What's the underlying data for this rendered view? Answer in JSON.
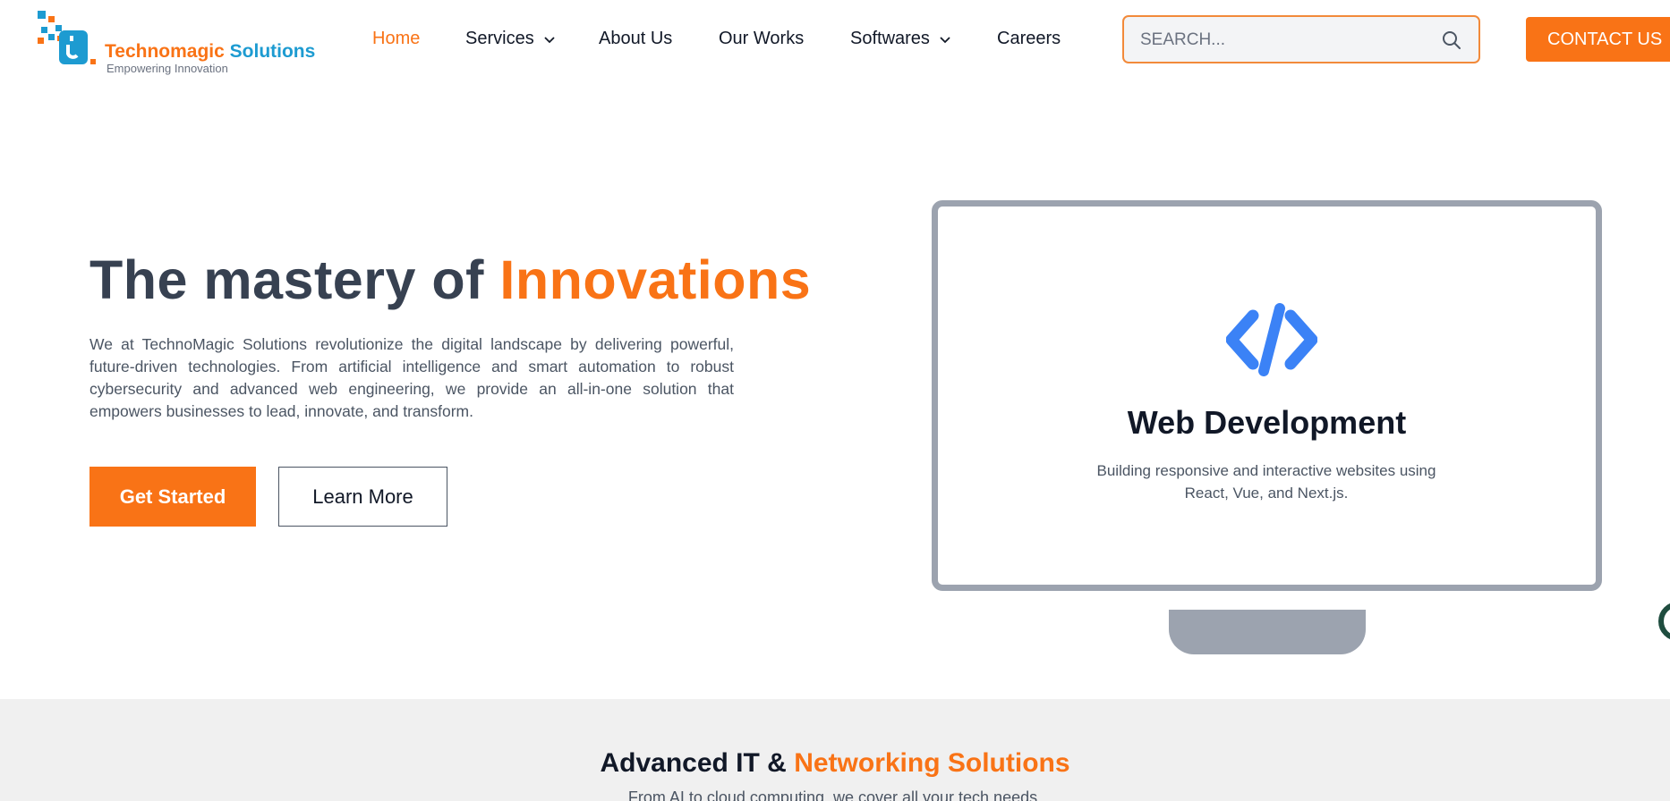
{
  "header": {
    "logo": {
      "name_part1": "Technomagic",
      "name_part2": "Solutions",
      "tagline": "Empowering Innovation"
    },
    "nav": [
      {
        "label": "Home",
        "active": true
      },
      {
        "label": "Services",
        "dropdown": true
      },
      {
        "label": "About Us"
      },
      {
        "label": "Our Works"
      },
      {
        "label": "Softwares",
        "dropdown": true
      },
      {
        "label": "Careers"
      }
    ],
    "search": {
      "placeholder": "SEARCH...",
      "value": ""
    },
    "contact_label": "CONTACT US"
  },
  "hero": {
    "title_part1": "The mastery of",
    "title_accent": "Innovations",
    "description": "We at TechnoMagic Solutions revolutionize the digital landscape by delivering powerful, future-driven technologies. From artificial intelligence and smart automation to robust cybersecurity and advanced web engineering, we provide an all-in-one solution that empowers businesses to lead, innovate, and transform.",
    "primary_cta": "Get Started",
    "secondary_cta": "Learn More"
  },
  "showcase": {
    "icon": "code-icon",
    "title": "Web Development",
    "text": "Building responsive and interactive websites using React, Vue, and Next.js."
  },
  "section": {
    "title_part1": "Advanced IT &",
    "title_accent": "Networking Solutions",
    "subtitle": "From AI to cloud computing, we cover all your tech needs."
  },
  "colors": {
    "accent": "#f97316",
    "brand_blue": "#1d9bd1",
    "icon_blue": "#3b82f6",
    "heading": "#374151"
  }
}
